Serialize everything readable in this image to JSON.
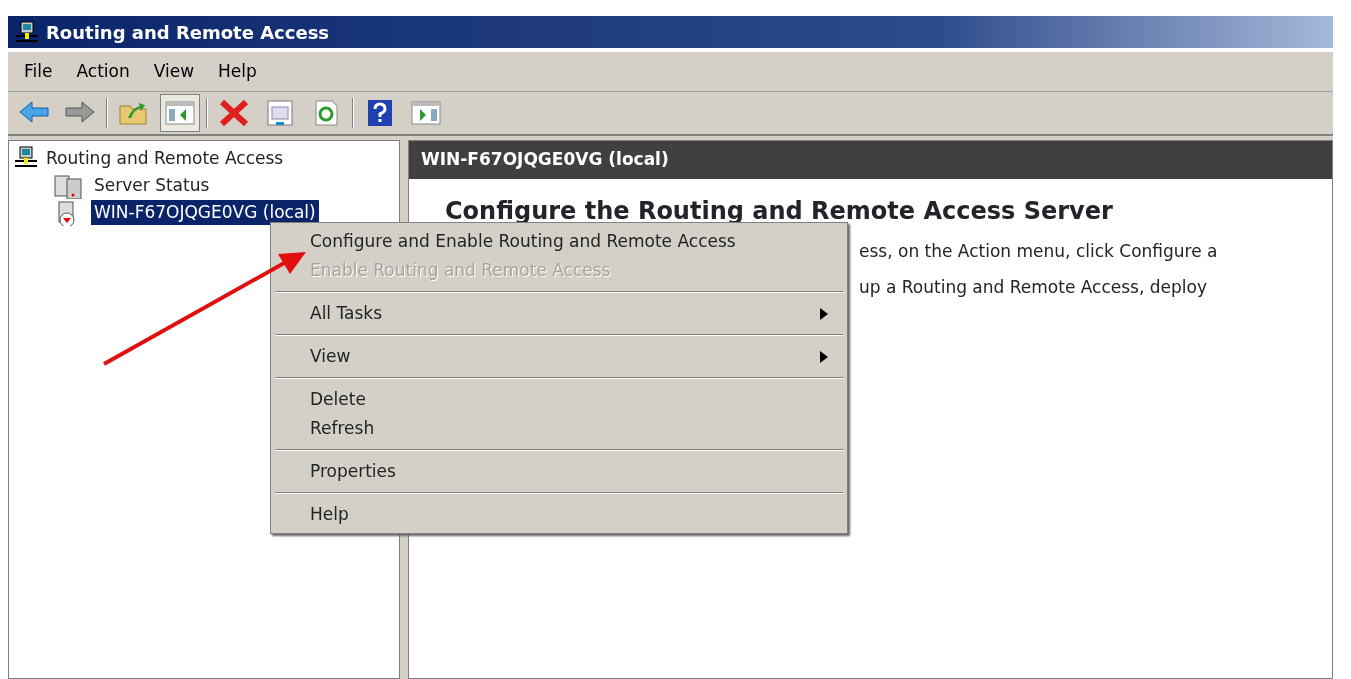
{
  "window": {
    "title": "Routing and Remote Access"
  },
  "menu_bar": [
    "File",
    "Action",
    "View",
    "Help"
  ],
  "toolbar": [
    {
      "kind": "back",
      "pressed": false
    },
    {
      "kind": "forward",
      "pressed": false
    },
    {
      "kind": "separator"
    },
    {
      "kind": "up",
      "pressed": false
    },
    {
      "kind": "tree",
      "pressed": true
    },
    {
      "kind": "separator"
    },
    {
      "kind": "delete",
      "pressed": false
    },
    {
      "kind": "properties",
      "pressed": false
    },
    {
      "kind": "refresh",
      "pressed": false
    },
    {
      "kind": "separator"
    },
    {
      "kind": "help",
      "pressed": false
    },
    {
      "kind": "actionpane",
      "pressed": false
    }
  ],
  "tree": [
    {
      "label": "Routing and Remote Access",
      "kind": "network",
      "selected": false,
      "children": [
        {
          "label": "Server Status",
          "kind": "servers",
          "selected": false
        },
        {
          "label": "WIN-F67OJQGE0VG (local)",
          "kind": "stopped",
          "selected": true
        }
      ]
    }
  ],
  "content": {
    "header": "WIN-F67OJQGE0VG (local)",
    "heading": "Configure the Routing and Remote Access Server",
    "lines": [
      "ess, on the Action menu, click Configure a",
      "up a Routing and Remote Access, deploy"
    ]
  },
  "context_menu": [
    {
      "kind": "item",
      "label": "Configure and Enable Routing and Remote Access",
      "disabled": false,
      "submenu": false
    },
    {
      "kind": "item",
      "label": "Enable Routing and Remote Access",
      "disabled": true,
      "submenu": false
    },
    {
      "kind": "separator"
    },
    {
      "kind": "item",
      "label": "All Tasks",
      "disabled": false,
      "submenu": true
    },
    {
      "kind": "separator"
    },
    {
      "kind": "item",
      "label": "View",
      "disabled": false,
      "submenu": true
    },
    {
      "kind": "separator"
    },
    {
      "kind": "item",
      "label": "Delete",
      "disabled": false,
      "submenu": false
    },
    {
      "kind": "item",
      "label": "Refresh",
      "disabled": false,
      "submenu": false
    },
    {
      "kind": "separator"
    },
    {
      "kind": "item",
      "label": "Properties",
      "disabled": false,
      "submenu": false
    },
    {
      "kind": "separator"
    },
    {
      "kind": "item",
      "label": "Help",
      "disabled": false,
      "submenu": false
    }
  ]
}
